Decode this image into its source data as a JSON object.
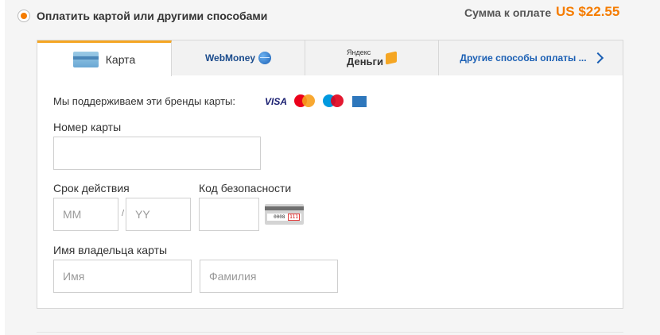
{
  "payment_option": {
    "label": "Оплатить картой или другими способами",
    "selected": true
  },
  "amount": {
    "label": "Сумма к оплате",
    "value": "US $22.55"
  },
  "tabs": [
    {
      "label": "Карта",
      "icon": "card-icon",
      "active": true
    },
    {
      "label": "WebMoney",
      "icon": "webmoney-globe-icon",
      "active": false
    },
    {
      "label_small": "Яндекс",
      "label": "Деньги",
      "icon": "yandex-wallet-icon",
      "active": false
    },
    {
      "label": "Другие способы оплаты ...",
      "icon": "chevron-right-icon",
      "active": false
    }
  ],
  "brands": {
    "label": "Мы поддерживаем эти бренды карты:",
    "items": [
      "VISA",
      "MasterCard",
      "Maestro",
      "American Express"
    ]
  },
  "form": {
    "card_number_label": "Номер карты",
    "card_number_value": "",
    "expiry_label": "Срок действия",
    "month_placeholder": "MM",
    "separator": "/",
    "year_placeholder": "YY",
    "cvv_label": "Код безопасности",
    "cvv_example": "0008",
    "cvv_highlight": "111",
    "holder_label": "Имя владельца карты",
    "first_name_placeholder": "Имя",
    "last_name_placeholder": "Фамилия"
  },
  "colors": {
    "accent": "#f57c00",
    "tab_active_border": "#f5a623",
    "link": "#1a5fb4"
  }
}
